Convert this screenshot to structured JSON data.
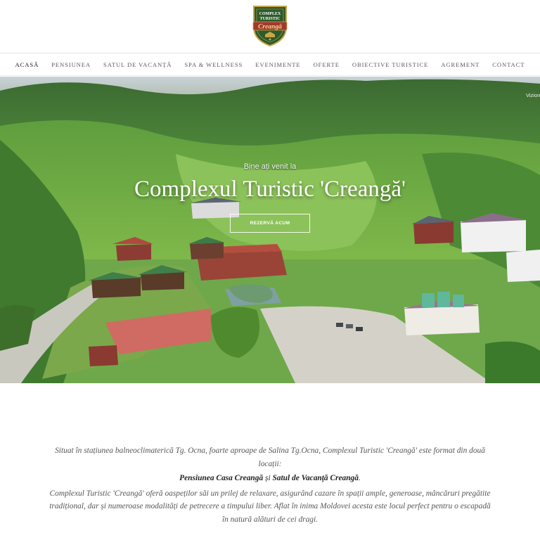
{
  "logo": {
    "line1": "COMPLEX",
    "line2": "TURISTIC",
    "line3": "Creangă",
    "icon": "shield-logo-icon",
    "colors": {
      "shield": "#2d5a2b",
      "gold": "#c9a64a",
      "red": "#a0392f"
    }
  },
  "nav": {
    "items": [
      {
        "label": "ACASĂ",
        "active": true
      },
      {
        "label": "PENSIUNEA",
        "active": false
      },
      {
        "label": "SATUL DE VACANȚĂ",
        "active": false
      },
      {
        "label": "SPA & WELLNESS",
        "active": false
      },
      {
        "label": "EVENIMENTE",
        "active": false
      },
      {
        "label": "OFERTE",
        "active": false
      },
      {
        "label": "OBIECTIVE TURISTICE",
        "active": false
      },
      {
        "label": "AGREMENT",
        "active": false
      },
      {
        "label": "CONTACT",
        "active": false
      }
    ]
  },
  "hero": {
    "welcome": "Bine ați venit la",
    "title": "Complexul Turistic 'Creangă'",
    "button": "REZERVĂ ACUM",
    "side_text": "Vizion"
  },
  "content": {
    "p1": "Situat în stațiunea balneoclimaterică Tg. Ocna, foarte aproape de Salina Tg.Ocna, Complexul Turistic 'Creangă' este format din două locații:",
    "p2_a": "Pensiunea Casa Creangă",
    "p2_b": " și ",
    "p2_c": "Satul de Vacanță Creangă",
    "p2_d": ".",
    "p3": "Complexul Turistic 'Creangă' oferă oaspeților săi un prilej de relaxare, asigurând cazare în spații ample, generoase, mâncăruri pregătite tradițional, dar și numeroase modalități de petrecere a timpului liber. Aflat în inima Moldovei acesta este locul perfect pentru o escapadă în natură alături de cei dragi."
  }
}
